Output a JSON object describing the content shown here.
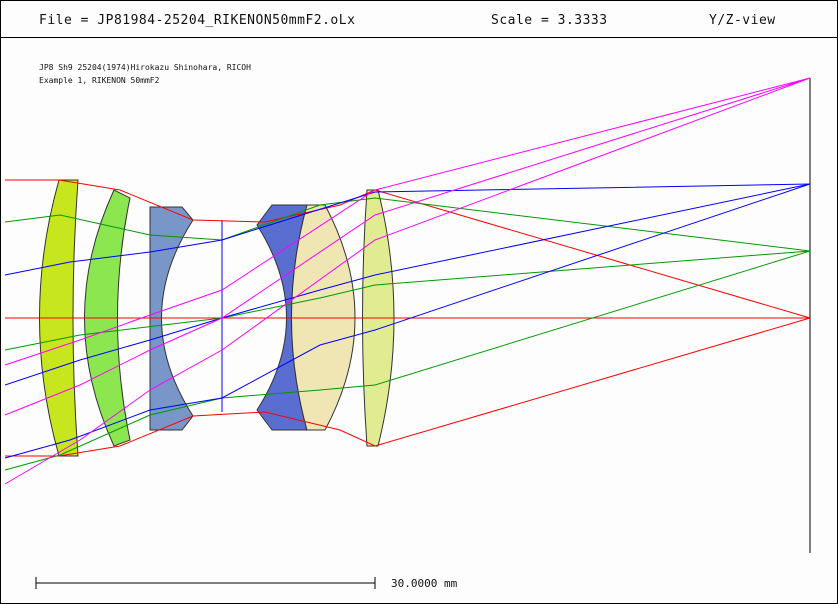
{
  "header": {
    "file": "File = JP81984-25204_RIKENON50mmF2.oLx",
    "scale": "Scale = 3.3333",
    "view": "Y/Z-view"
  },
  "reference": {
    "line1": "JP8 Sh9 25204(1974)Hirokazu Shinohara, RICOH",
    "line2": "Example 1, RIKENON 50mmF2"
  },
  "scalebar": {
    "label": "30.0000 mm"
  },
  "colors": {
    "ray_axial": "#ff0000",
    "ray_field1": "#009900",
    "ray_field2": "#0000ff",
    "ray_field3": "#ff00ff",
    "lens1": "#c8e61e",
    "lens2": "#8ce650",
    "lens3": "#7896c8",
    "lens4": "#5a6ed2",
    "lens5": "#f0e6b4",
    "lens6": "#e1eb91"
  }
}
